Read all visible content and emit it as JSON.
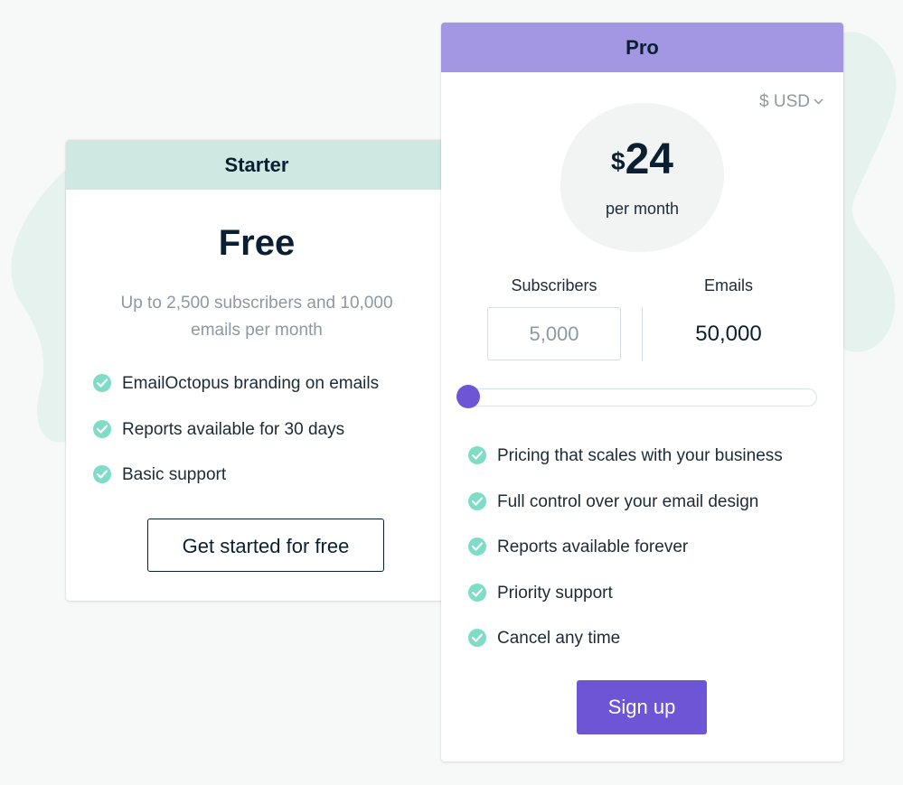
{
  "colors": {
    "starter_header": "#cfe8e1",
    "pro_header": "#a397e3",
    "accent": "#6d55d6",
    "check": "#7fdcc7",
    "text_dark": "#0b1f33",
    "text_muted": "#8c98a4"
  },
  "starter": {
    "title": "Starter",
    "price_label": "Free",
    "description": "Up to 2,500 subscribers and 10,000 emails per month",
    "features": [
      "EmailOctopus branding on emails",
      "Reports available for 30 days",
      "Basic support"
    ],
    "cta_label": "Get started for free",
    "check_icon": "check-circle-icon"
  },
  "pro": {
    "title": "Pro",
    "currency": "$ USD",
    "currency_icon": "chevron-down-icon",
    "price_symbol": "$",
    "price_amount": "24",
    "price_period": "per month",
    "subscribers_label": "Subscribers",
    "subscribers_value": "5,000",
    "emails_label": "Emails",
    "emails_value": "50,000",
    "slider_level": 0,
    "features": [
      "Pricing that scales with your business",
      "Full control over your email design",
      "Reports available forever",
      "Priority support",
      "Cancel any time"
    ],
    "cta_label": "Sign up"
  }
}
